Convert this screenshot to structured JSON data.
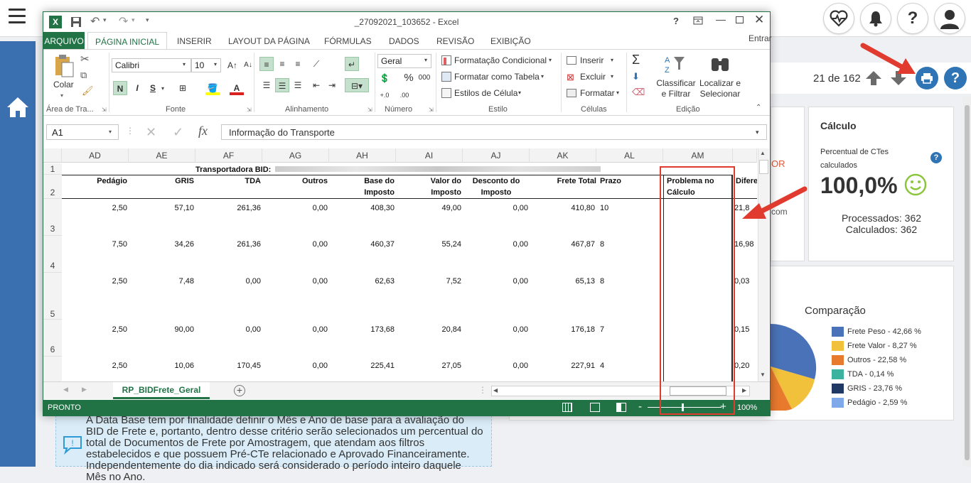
{
  "app": {
    "top_icons": [
      "heart-pulse-icon",
      "bell-icon",
      "help-icon",
      "user-avatar-icon"
    ],
    "page_counter": "21 de 162",
    "calc_card": {
      "title": "Cálculo",
      "subtitle": "Percentual de CTes calculados",
      "percent": "100,0%",
      "processed": "Processados: 362",
      "calculated": "Calculados: 362"
    },
    "left_card_fragments": {
      "top": "OR",
      "mid": "com"
    },
    "comparison": {
      "title": "Comparação",
      "legend": [
        {
          "label": "Frete Peso - 42,66 %",
          "color": "#4a72b8"
        },
        {
          "label": "Frete Valor - 8,27 %",
          "color": "#f2c13c"
        },
        {
          "label": "Outros - 22,58 %",
          "color": "#e87a2e"
        },
        {
          "label": "TDA - 0,14 %",
          "color": "#3bb39f"
        },
        {
          "label": "GRIS - 23,76 %",
          "color": "#1f3864"
        },
        {
          "label": "Pedágio - 2,59 %",
          "color": "#7fa9e8"
        }
      ]
    },
    "info_text": "A Data Base tem por finalidade definir o Mês e Ano de base para a avaliação do BID de Frete e, portanto, dentro desse critério serão selecionados um percentual do total de Documentos de Frete por Amostragem, que atendam aos filtros estabelecidos e que possuem Pré-CTe relacionado e Aprovado Financeiramente. Independentemente do dia indicado será considerado o período inteiro daquele Mês no Ano."
  },
  "excel": {
    "title": "_27092021_103652 - Excel",
    "menu_tabs": [
      "ARQUIVO",
      "PÁGINA INICIAL",
      "INSERIR",
      "LAYOUT DA PÁGINA",
      "FÓRMULAS",
      "DADOS",
      "REVISÃO",
      "EXIBIÇÃO"
    ],
    "entrar": "Entrar",
    "ribbon": {
      "colar": "Colar",
      "font_name": "Calibri",
      "font_size": "10",
      "number_format": "Geral",
      "bold": "N",
      "italic": "I",
      "underline": "S",
      "percent": "%",
      "thousands": "000",
      "formatacao_condicional": "Formatação Condicional",
      "formatar_tabela": "Formatar como Tabela",
      "estilos_celula": "Estilos de Célula",
      "inserir": "Inserir",
      "excluir": "Excluir",
      "formatar": "Formatar",
      "classificar": "Classificar e Filtrar",
      "localizar": "Localizar e Selecionar",
      "groups": [
        "Área de Tra...",
        "Fonte",
        "Alinhamento",
        "Número",
        "Estilo",
        "Células",
        "Edição"
      ]
    },
    "name_box": "A1",
    "formula": "Informação do Transporte",
    "columns": [
      "AD",
      "AE",
      "AF",
      "AG",
      "AH",
      "AI",
      "AJ",
      "AK",
      "AL",
      "AM"
    ],
    "row_numbers": [
      "1",
      "2",
      "3",
      "4",
      "5",
      "6"
    ],
    "row1_label": "Transportadora BID:",
    "headers": {
      "pedagio": "Pedágio",
      "gris": "GRIS",
      "tda": "TDA",
      "outros": "Outros",
      "base1": "Base do",
      "base2": "Imposto",
      "valor1": "Valor do",
      "valor2": "Imposto",
      "desc1": "Desconto do",
      "desc2": "Imposto",
      "frete_total": "Frete Total",
      "prazo": "Prazo",
      "problema1": "Problema no",
      "problema2": "Cálculo",
      "diferenca": "Difere"
    },
    "rows": [
      [
        "2,50",
        "57,10",
        "261,36",
        "0,00",
        "408,30",
        "49,00",
        "0,00",
        "410,80",
        "10",
        "21,8"
      ],
      [
        "7,50",
        "34,26",
        "261,36",
        "0,00",
        "460,37",
        "55,24",
        "0,00",
        "467,87",
        "8",
        "16,98"
      ],
      [
        "2,50",
        "7,48",
        "0,00",
        "0,00",
        "62,63",
        "7,52",
        "0,00",
        "65,13",
        "8",
        "0,03"
      ],
      [
        "2,50",
        "90,00",
        "0,00",
        "0,00",
        "173,68",
        "20,84",
        "0,00",
        "176,18",
        "7",
        "0,15"
      ],
      [
        "2,50",
        "10,06",
        "170,45",
        "0,00",
        "225,41",
        "27,05",
        "0,00",
        "227,91",
        "4",
        "0,20"
      ]
    ],
    "sheet_tab": "RP_BIDFrete_Geral",
    "status": "PRONTO",
    "zoom": "100%"
  }
}
